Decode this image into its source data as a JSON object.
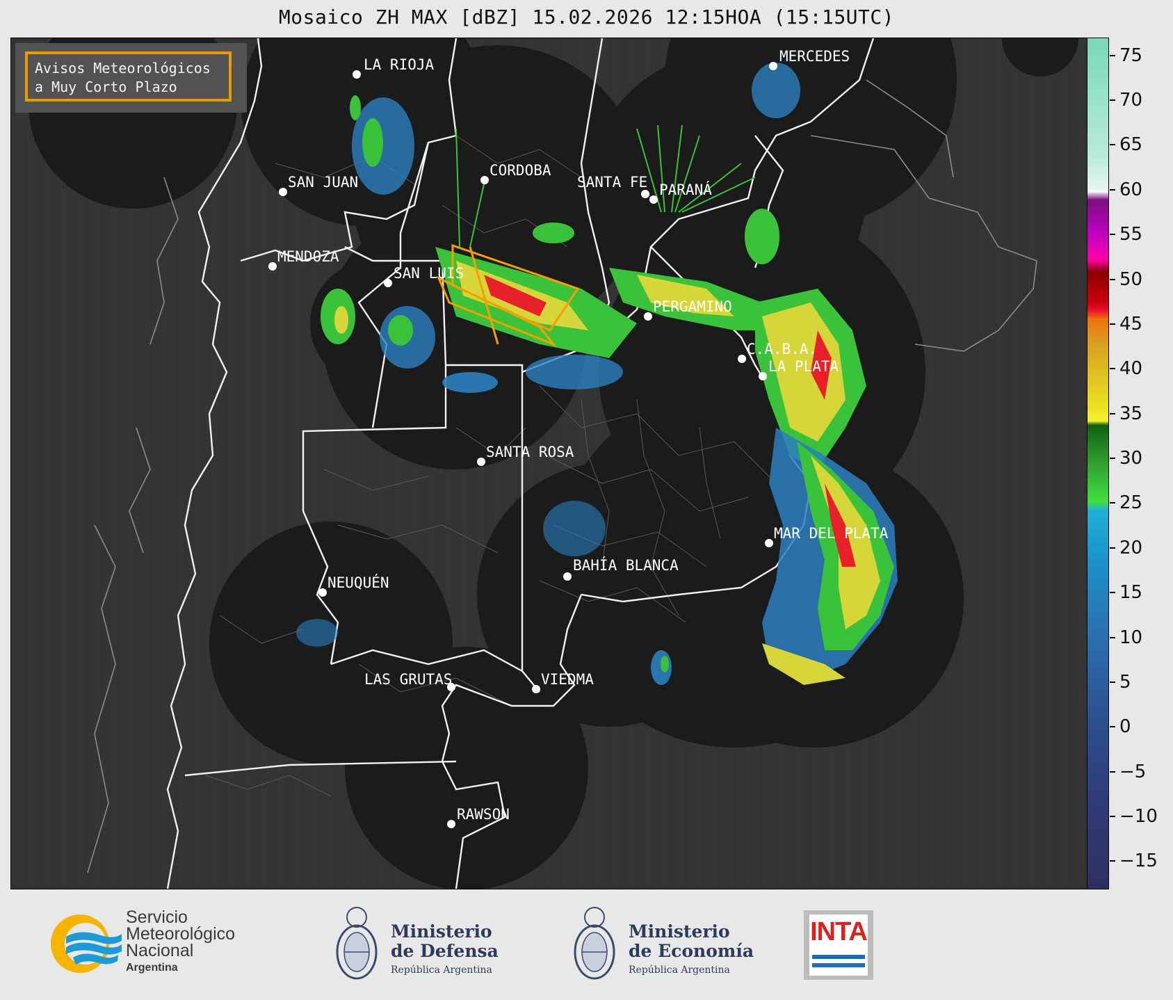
{
  "title": "Mosaico ZH MAX [dBZ] 15.02.2026 12:15HOA (15:15UTC)",
  "notice": {
    "line1": "Avisos Meteorológicos",
    "line2": "a Muy Corto Plazo",
    "border_color": "#f5a000"
  },
  "colorbar": {
    "unit": "dBZ",
    "min": -18,
    "max": 77,
    "ticks": [
      75,
      70,
      65,
      60,
      55,
      50,
      45,
      40,
      35,
      30,
      25,
      20,
      15,
      10,
      5,
      0,
      -5,
      -10,
      -15
    ],
    "tick_labels": [
      "75",
      "70",
      "65",
      "60",
      "55",
      "50",
      "45",
      "40",
      "35",
      "30",
      "25",
      "20",
      "15",
      "10",
      "5",
      "0",
      "−5",
      "−10",
      "−15"
    ]
  },
  "cities": [
    {
      "name": "LA RIOJA",
      "label": "LA RIOJA"
    },
    {
      "name": "MERCEDES",
      "label": "MERCEDES"
    },
    {
      "name": "SAN JUAN",
      "label": "SAN JUAN"
    },
    {
      "name": "CORDOBA",
      "label": "CORDOBA"
    },
    {
      "name": "SANTA FE",
      "label": "SANTA FE"
    },
    {
      "name": "PARANA",
      "label": "PARANÁ"
    },
    {
      "name": "MENDOZA",
      "label": "MENDOZA"
    },
    {
      "name": "SAN LUIS",
      "label": "SAN LUIS"
    },
    {
      "name": "PERGAMINO",
      "label": "PERGAMINO"
    },
    {
      "name": "CABA",
      "label": "C.A.B.A."
    },
    {
      "name": "LA PLATA",
      "label": "LA PLATA"
    },
    {
      "name": "SANTA ROSA",
      "label": "SANTA ROSA"
    },
    {
      "name": "MAR DEL PLATA",
      "label": "MAR DEL PLATA"
    },
    {
      "name": "BAHIA BLANCA",
      "label": "BAHÍA BLANCA"
    },
    {
      "name": "NEUQUEN",
      "label": "NEUQUÉN"
    },
    {
      "name": "LAS GRUTAS",
      "label": "LAS GRUTAS"
    },
    {
      "name": "VIEDMA",
      "label": "VIEDMA"
    },
    {
      "name": "RAWSON",
      "label": "RAWSON"
    }
  ],
  "logos": {
    "smn": {
      "line1": "Servicio",
      "line2": "Meteorológico",
      "line3": "Nacional",
      "line4": "Argentina"
    },
    "defensa": {
      "line1": "Ministerio",
      "line2": "de Defensa",
      "line3": "República Argentina"
    },
    "economia": {
      "line1": "Ministerio",
      "line2": "de Economía",
      "line3": "República Argentina"
    },
    "inta": {
      "text": "INTA"
    }
  },
  "colors": {
    "background": "#e8e8e8",
    "map_land": "#333333",
    "radar_coverage": "#1b1b1b",
    "warning_polygon": "#f5a000"
  }
}
